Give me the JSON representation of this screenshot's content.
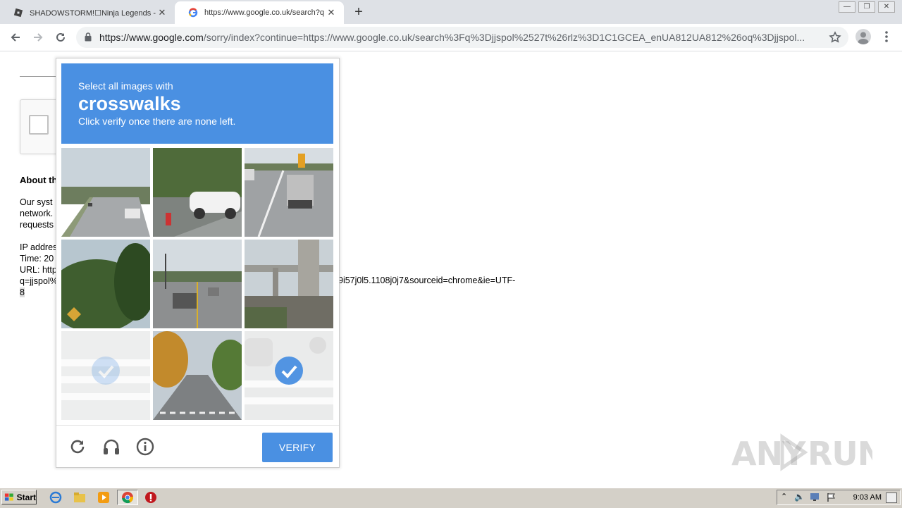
{
  "browser": {
    "tabs": [
      {
        "title": "SHADOWSTORM!☐Ninja Legends - F",
        "close": "✕"
      },
      {
        "title": "https://www.google.co.uk/search?q",
        "close": "✕"
      }
    ],
    "new_tab": "+",
    "url_host": "https://www.google.com",
    "url_rest": "/sorry/index?continue=https://www.google.co.uk/search%3Fq%3Djjspol%2527t%26rlz%3D1C1GCEA_enUA812UA812%26oq%3Djjspol..."
  },
  "page": {
    "about_heading": "About th",
    "para1": [
      "Our syst",
      "network.",
      "requests"
    ],
    "para2": [
      "IP addres",
      "Time: 20",
      "URL: http",
      "q=jjspol%"
    ],
    "url_tail": "9i57j0l5.1108j0j7&sourceid=chrome&ie=UTF-",
    "url_end": "8"
  },
  "captcha": {
    "instruction_line1": "Select all images with",
    "keyword": "crosswalks",
    "instruction_line3": "Click verify once there are none left.",
    "verify_label": "VERIFY",
    "tiles": [
      {
        "scene": "highway",
        "selected": false
      },
      {
        "scene": "parking-lot-car",
        "selected": false
      },
      {
        "scene": "highway-trucks",
        "selected": false
      },
      {
        "scene": "trees-sign",
        "selected": false
      },
      {
        "scene": "street-intersection",
        "selected": false
      },
      {
        "scene": "overpass",
        "selected": false
      },
      {
        "scene": "crosswalk-faded",
        "selected": true
      },
      {
        "scene": "tree-lined-street",
        "selected": false
      },
      {
        "scene": "crosswalk-faded",
        "selected": true
      }
    ],
    "accent_color": "#4a90e2"
  },
  "watermark": "ANY RUN",
  "taskbar": {
    "start_label": "Start",
    "clock": "9:03 AM"
  }
}
